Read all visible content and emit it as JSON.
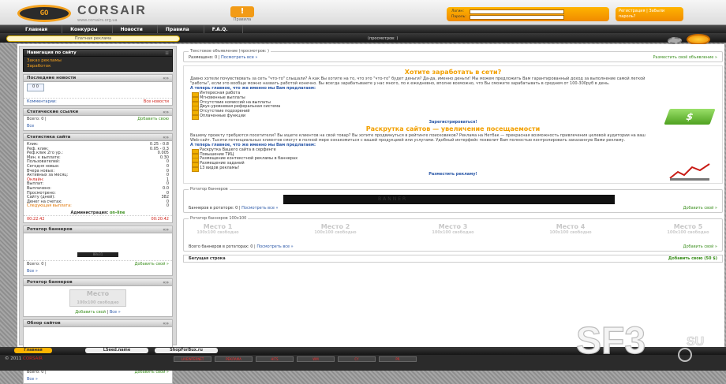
{
  "header": {
    "logo_badge": "GO",
    "brand": "CORSAIR",
    "site_url": "www.corsairs.org.ua",
    "rules_label": "Правила",
    "login_label": "Логин:",
    "password_label": "Пароль:",
    "register_text": "Регистрация | Забыли пароль?"
  },
  "nav": {
    "items": [
      "Главная",
      "Конкурсы",
      "Новости",
      "Правила",
      "F.A.Q."
    ]
  },
  "subnav": {
    "promo_tab": "Платная реклама",
    "views": "(просмотров: )"
  },
  "sidebar": {
    "nav_block": {
      "title": "Навигация по сайту",
      "items": [
        "Заказ рекламы",
        "Заработок"
      ]
    },
    "news": {
      "title": "Последние новости",
      "counter": "0 0",
      "comments": "Комментарии:",
      "all_link": "Все новости"
    },
    "static_links": {
      "title": "Статические ссылки",
      "total": "Всего: 0 |",
      "add": "Добавить свою",
      "all": "Все"
    },
    "stats": {
      "title": "Статистика сайта",
      "rows": [
        {
          "k": "Клик:",
          "v": "0.25 - 0.8"
        },
        {
          "k": "Реф. клик:",
          "v": "0.05 - 0.3"
        },
        {
          "k": "Реф.клик 2го ур.:",
          "v": "0.005"
        },
        {
          "k": "Мин. к выплате:",
          "v": "0.30"
        },
        {
          "k": "Пользователей:",
          "v": "0"
        },
        {
          "k": "Сегодня новых:",
          "v": "0"
        },
        {
          "k": "Вчера новых:",
          "v": "0"
        },
        {
          "k": "Активных за месяц:",
          "v": "0"
        },
        {
          "k": "Онлайн:",
          "v": "1"
        },
        {
          "k": "Выплат:",
          "v": "0"
        },
        {
          "k": "Выплачено:",
          "v": "0.0"
        },
        {
          "k": "Просмотрено:",
          "v": "0"
        },
        {
          "k": "Сайту (дней):",
          "v": "382"
        },
        {
          "k": "Денег на счетах:",
          "v": "0"
        },
        {
          "k": "Следующая выплата:",
          "v": "0"
        }
      ],
      "admin_label": "Администрация:",
      "admin_status": "on-line",
      "time_left": "00:22:42",
      "time_right": "00:20:42"
    },
    "rotator": {
      "title": "Ротатор баннеров",
      "banner_text": "88x31",
      "total": "Всего: 0 |",
      "add": "Добавить свой »",
      "all": "Все »"
    },
    "rotator2": {
      "title": "Ротатор баннеров",
      "place": "Место",
      "place_sub": "100x100 свободно",
      "add": "Добавить свой",
      "all": "Все »"
    },
    "review": {
      "title": "Обзоp сайтов",
      "total": "Всего: 0 |",
      "add": "Добавить свой »",
      "all": "Все »"
    }
  },
  "main": {
    "text_ad": {
      "legend": "Текстовое объявление (просмотров: )",
      "placed": "Размещено: 0 |",
      "view_all": "Посмотреть все »",
      "place_link": "Разместить своё объявление »"
    },
    "promo": {
      "title1": "Хотите заработать в сети?",
      "text1": "Давно хотели почувствовать за сеть \"что-то\" слышали? А как Вы хотите на то, что это \"что-то\" будет деньги? Да-да, именно деньги! Мы можем предложить Вам гарантированный доход за выполнение самой легкой \"работы\", если это вообще можно назвать работой конечно. Вы всегда зарабатываете у нас много, по к ежедневно, вполне возможно, что Вы сможете зарабатывать в среднем от 100-300руб в день.",
      "subtitle1": "А теперь главное, что же именно мы Вам предлагаем:",
      "list1": [
        "Интересная работа",
        "Мгновенные выплаты",
        "Отсутствие комиссий на выплаты",
        "Двух-уровневая реферальная система",
        "Отсутствие подозрений",
        "Оплаченные функции"
      ],
      "cta1": "Зарегистрироваться!",
      "title2": "Раскрутка сайтов — увеличение посещаемости",
      "text2": "Вашему проекту требуются посетители? Вы ищете клиентов на свой товар? Вы хотите продвинуться в рейтинге поисковиков? Реклама на Нетбак — прекрасная возможность привлечения целевой аудитории на ваш Web-сайт. Тысячи потенциальных клиентов смогут в полной мере ознакомиться с вашей продукцией или услугами. Удобный интерфейс позволит Вам полностью контролировать заказанную Вами рекламу.",
      "subtitle2": "А теперь главное, что же именно мы Вам предлагаем:",
      "list2": [
        "Раскрутка Вашего сайта в серфинге",
        "Повышение ТИЦ",
        "Размещение контекстной рекламы в баннерах",
        "Размещение заданий",
        "13 видов рекламы!"
      ],
      "cta2": "Разместить рекламу!",
      "money_symbol": "$"
    },
    "banner_rotator": {
      "legend": "Ротатор баннеров",
      "banner": "BANNER",
      "placed": "Баннеров в ротаторе: 0 |",
      "view_all": "Посмотреть все »",
      "add": "Добавить свой »"
    },
    "banner_rotator_100": {
      "legend": "Ротатор баннеров 100x100",
      "places": [
        "Место 1",
        "Место 2",
        "Место 3",
        "Место 4",
        "Место 5"
      ],
      "place_sub": "100x100 свободно",
      "placed": "Всего баннеров в ротаторах: 0 |",
      "view_all": "Посмотреть все »",
      "add": "Добавить свой »"
    },
    "running_line": {
      "label": "Бегущая строка",
      "add": "Добавить свою (50 $)"
    }
  },
  "footer": {
    "buttons": [
      "Главная",
      "LSeed.name",
      "ShopForBux.ru"
    ],
    "copyright": "© 2011",
    "copyright_brand": "CORSAIR",
    "counters": [
      "LIVEINTERNET",
      "РЕКЛАМА",
      "HITS",
      "WM",
      "CY",
      "PR"
    ],
    "watermark": "SF3",
    "watermark_tld": "SU"
  },
  "colors": {
    "accent": "#f29b16",
    "link": "#2a57a7",
    "add_green": "#3b8f1e",
    "dark": "#2b2b2b"
  }
}
